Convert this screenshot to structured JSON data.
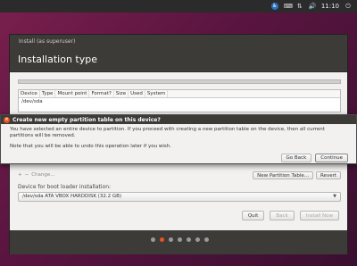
{
  "panel": {
    "accessibility_icon": "accessibility-icon",
    "keyboard_icon": "keyboard-icon",
    "network_icon": "network-icon",
    "sound_icon": "volume-icon",
    "time": "11:10",
    "power_icon": "power-icon"
  },
  "window": {
    "title": "Install (as superuser)",
    "header": "Installation type"
  },
  "table": {
    "columns": [
      "Device",
      "Type",
      "Mount point",
      "Format?",
      "Size",
      "Used",
      "System"
    ],
    "rows": [
      "/dev/sda"
    ]
  },
  "tools": {
    "add": "+",
    "remove": "−",
    "change": "Change...",
    "new_partition_table": "New Partition Table...",
    "revert": "Revert"
  },
  "boot": {
    "label": "Device for boot loader installation:",
    "value": "/dev/sda  ATA VBOX HARDDISK (32.2 GB)"
  },
  "nav": {
    "quit": "Quit",
    "back": "Back",
    "install_now": "Install Now"
  },
  "dialog": {
    "title": "Create new empty partition table on this device?",
    "message": "You have selected an entire device to partition. If you proceed with creating a new partition table on the device, then all current partitions will be removed.",
    "note": "Note that you will be able to undo this operation later if you wish.",
    "go_back": "Go Back",
    "continue": "Continue"
  },
  "progress": {
    "steps": 7,
    "current": 1
  },
  "colors": {
    "accent": "#e95420",
    "header_bg": "#3c3b37"
  }
}
